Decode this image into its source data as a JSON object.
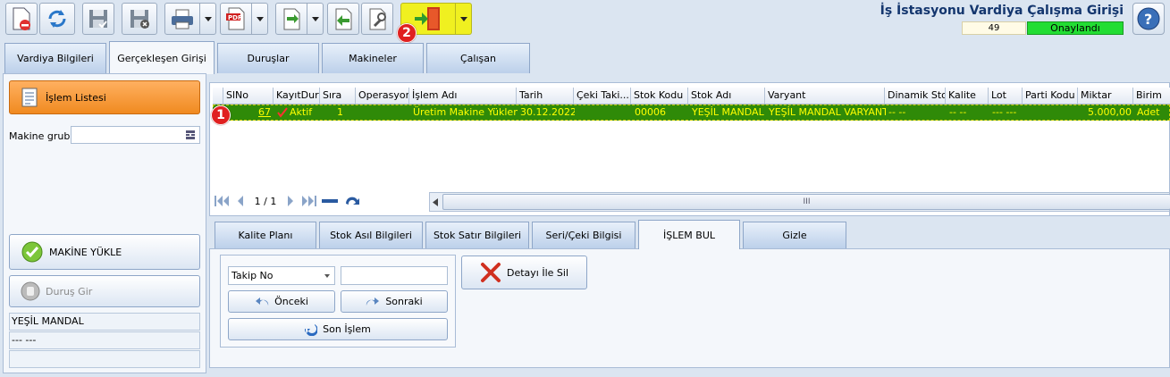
{
  "header": {
    "title": "İş İstasyonu Vardiya Çalışma Girişi",
    "record_no": "49",
    "status": "Onaylandı",
    "status_color": "#22dd33"
  },
  "toolbar": {
    "icons": [
      "new-delete-icon",
      "refresh-icon",
      "save-icon",
      "save-close-icon",
      "print-icon",
      "pdf-icon",
      "export-icon",
      "back-icon",
      "tools-icon",
      "exit-door-icon"
    ]
  },
  "tabs": [
    {
      "label": "Vardiya Bilgileri"
    },
    {
      "label": "Gerçekleşen Girişi"
    },
    {
      "label": "Duruşlar"
    },
    {
      "label": "Makineler"
    },
    {
      "label": "Çalışan"
    }
  ],
  "sidebar": {
    "islem_listesi": "İşlem Listesi",
    "makine_grubu_label": "Makine grubu",
    "makine_yukle": "MAKİNE YÜKLE",
    "durus_gir": "Duruş Gir",
    "info": [
      "YEŞİL MANDAL",
      "--- ---",
      ""
    ]
  },
  "grid": {
    "columns": [
      "SlNo",
      "KayıtDuru...",
      "Sıra",
      "Operasyon",
      "İşlem Adı",
      "Tarih",
      "Çeki Taki...",
      "Stok Kodu",
      "Stok Adı",
      "Varyant",
      "Dinamik Stok",
      "Kalite",
      "Lot",
      "Parti Kodu",
      "Miktar",
      "Birim"
    ],
    "row": {
      "slno": "67",
      "kayit": "Aktif",
      "sira": "1",
      "operasyon": "",
      "islem_adi": "Üretim Makine Yükleme",
      "tarih": "30.12.2022",
      "ceki": "",
      "stok_kodu": "00006",
      "stok_adi": "YEŞİL MANDAL",
      "varyant": "YEŞİL MANDAL VARYANTI",
      "dinamik": "-- --",
      "kalite": "-- --",
      "lot": "--- ---",
      "parti": "",
      "miktar": "5.000,00",
      "birim": "Adet"
    },
    "pager": "1 / 1",
    "scroll_mark": "III"
  },
  "bottom_tabs": [
    {
      "label": "Kalite Planı"
    },
    {
      "label": "Stok Asıl Bilgileri"
    },
    {
      "label": "Stok Satır Bilgileri"
    },
    {
      "label": "Seri/Çeki Bilgisi"
    },
    {
      "label": "İŞLEM BUL"
    },
    {
      "label": "Gizle"
    }
  ],
  "islem_bul": {
    "select_value": "Takip No",
    "onceki": "Önceki",
    "sonraki": "Sonraki",
    "son_islem": "Son İşlem",
    "detay_sil": "Detayı İle Sil"
  },
  "badges": {
    "one": "1",
    "two": "2"
  }
}
